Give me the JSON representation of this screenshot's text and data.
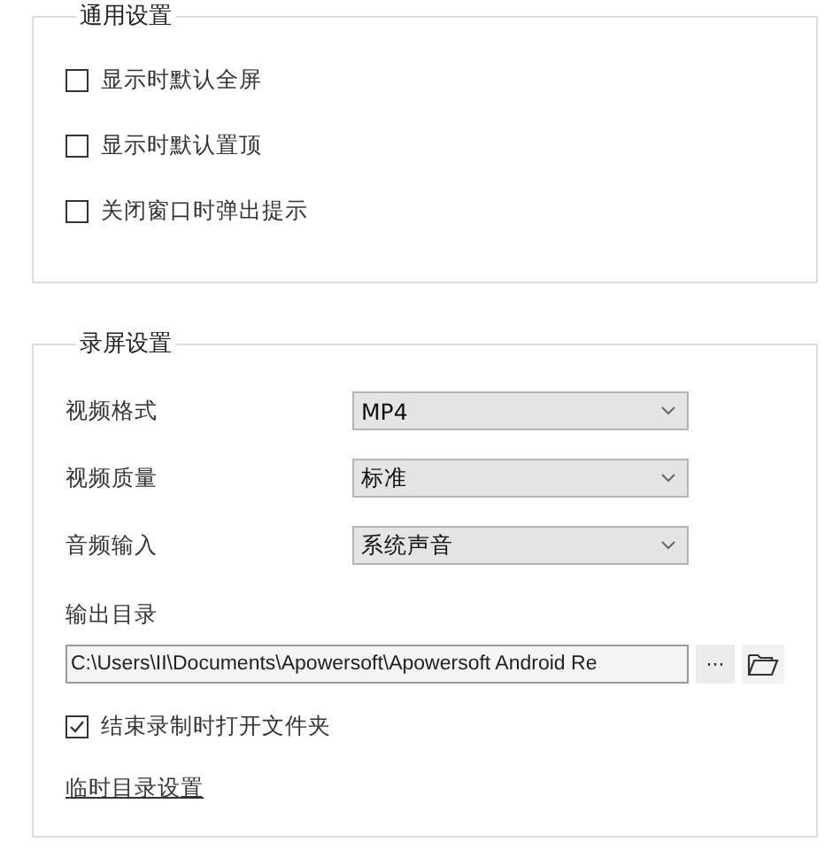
{
  "general": {
    "title": "通用设置",
    "options": [
      {
        "label": "显示时默认全屏",
        "checked": false
      },
      {
        "label": "显示时默认置顶",
        "checked": false
      },
      {
        "label": "关闭窗口时弹出提示",
        "checked": false
      }
    ]
  },
  "recording": {
    "title": "录屏设置",
    "selects": [
      {
        "label": "视频格式",
        "value": "MP4"
      },
      {
        "label": "视频质量",
        "value": "标准"
      },
      {
        "label": "音频输入",
        "value": "系统声音"
      }
    ],
    "output": {
      "label": "输出目录",
      "path": "C:\\Users\\II\\Documents\\Apowersoft\\Apowersoft Android Re",
      "browse": "···"
    },
    "open_folder": {
      "label": "结束录制时打开文件夹",
      "checked": true
    },
    "temp_link": "临时目录设置"
  }
}
